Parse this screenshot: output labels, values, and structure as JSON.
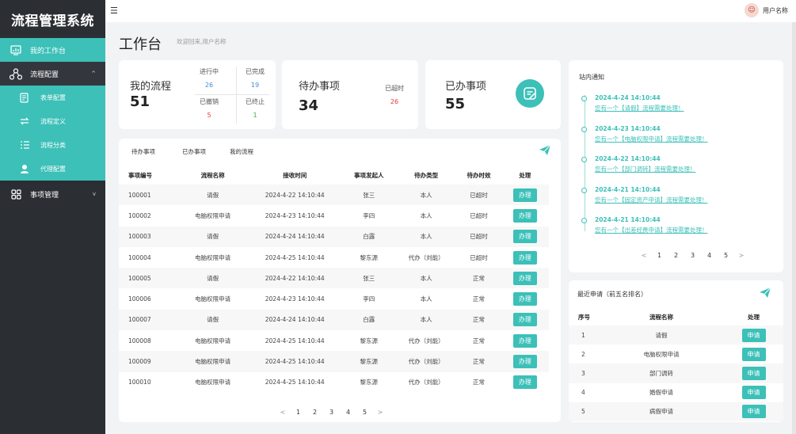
{
  "app": {
    "title": "流程管理系统"
  },
  "sidebar": {
    "items": [
      {
        "label": "我的工作台"
      },
      {
        "label": "流程配置"
      },
      {
        "label": "事项管理"
      }
    ],
    "sub_items": [
      {
        "label": "表单配置"
      },
      {
        "label": "流程定义"
      },
      {
        "label": "流程分类"
      },
      {
        "label": "代理配置"
      }
    ]
  },
  "topbar": {
    "user_name": "用户名称"
  },
  "header": {
    "title": "工作台",
    "subtitle": "欢迎回来,用户名称"
  },
  "stats": {
    "my_flow": {
      "title": "我的流程",
      "value": "51",
      "in_progress_label": "进行中",
      "in_progress": "26",
      "done_label": "已完成",
      "done": "19",
      "revoked_label": "已撤销",
      "revoked": "5",
      "stopped_label": "已终止",
      "stopped": "1"
    },
    "todo": {
      "title": "待办事项",
      "value": "34",
      "overdue_label": "已超时",
      "overdue": "26"
    },
    "done": {
      "title": "已办事项",
      "value": "55"
    }
  },
  "tasks": {
    "tabs": [
      "待办事项",
      "已办事项",
      "我的流程"
    ],
    "columns": [
      "事项编号",
      "流程名称",
      "接收时间",
      "事项发起人",
      "待办类型",
      "待办时效",
      "处理"
    ],
    "action_label": "办理",
    "rows": [
      {
        "id": "100001",
        "name": "请假",
        "time": "2024-4-22 14:10:44",
        "initiator": "张三",
        "type": "本人",
        "status": "已超时",
        "overdue": true
      },
      {
        "id": "100002",
        "name": "电脑权限申请",
        "time": "2024-4-23 14:10:44",
        "initiator": "李四",
        "type": "本人",
        "status": "已超时",
        "overdue": true
      },
      {
        "id": "100003",
        "name": "请假",
        "time": "2024-4-24 14:10:44",
        "initiator": "白露",
        "type": "本人",
        "status": "已超时",
        "overdue": true
      },
      {
        "id": "100004",
        "name": "电脑权限申请",
        "time": "2024-4-25 14:10:44",
        "initiator": "黎东源",
        "type": "代办（刘能）",
        "status": "已超时",
        "overdue": true
      },
      {
        "id": "100005",
        "name": "请假",
        "time": "2024-4-22 14:10:44",
        "initiator": "张三",
        "type": "本人",
        "status": "正常",
        "overdue": false
      },
      {
        "id": "100006",
        "name": "电脑权限申请",
        "time": "2024-4-23 14:10:44",
        "initiator": "李四",
        "type": "本人",
        "status": "正常",
        "overdue": false
      },
      {
        "id": "100007",
        "name": "请假",
        "time": "2024-4-24 14:10:44",
        "initiator": "白露",
        "type": "本人",
        "status": "正常",
        "overdue": false
      },
      {
        "id": "100008",
        "name": "电脑权限申请",
        "time": "2024-4-25 14:10:44",
        "initiator": "黎东源",
        "type": "代办（刘能）",
        "status": "正常",
        "overdue": false
      },
      {
        "id": "100009",
        "name": "电脑权限申请",
        "time": "2024-4-25 14:10:44",
        "initiator": "黎东源",
        "type": "代办（刘能）",
        "status": "正常",
        "overdue": false
      },
      {
        "id": "100010",
        "name": "电脑权限申请",
        "time": "2024-4-25 14:10:44",
        "initiator": "黎东源",
        "type": "代办（刘能）",
        "status": "正常",
        "overdue": false
      }
    ],
    "pager": {
      "prev": "<",
      "pages": [
        "1",
        "2",
        "3",
        "4",
        "5"
      ],
      "next": ">"
    }
  },
  "notifications": {
    "title": "站内通知",
    "items": [
      {
        "time": "2024-4-24 14:10:44",
        "message": "您有一个【请假】流程需要处理！"
      },
      {
        "time": "2024-4-23 14:10:44",
        "message": "您有一个【电脑权限申请】流程需要处理！"
      },
      {
        "time": "2024-4-22 14:10:44",
        "message": "您有一个【部门调转】流程需要处理！"
      },
      {
        "time": "2024-4-21 14:10:44",
        "message": "您有一个【固定资产申请】流程需要处理！"
      },
      {
        "time": "2024-4-21 14:10:44",
        "message": "您有一个【出差经费申请】流程需要处理！"
      }
    ],
    "pager": {
      "prev": "<",
      "pages": [
        "1",
        "2",
        "3",
        "4",
        "5"
      ],
      "next": ">"
    }
  },
  "recent": {
    "title": "最近申请（前五名排名）",
    "columns": [
      "序号",
      "流程名称",
      "处理"
    ],
    "action_label": "申请",
    "rows": [
      {
        "no": "1",
        "name": "请假"
      },
      {
        "no": "2",
        "name": "电脑权限申请"
      },
      {
        "no": "3",
        "name": "部门调转"
      },
      {
        "no": "4",
        "name": "婚假申请"
      },
      {
        "no": "5",
        "name": "病假申请"
      }
    ]
  },
  "colors": {
    "accent": "#3cc0b8",
    "sidebar": "#2b2e33",
    "overdue": "#e4393c"
  },
  "icons": {
    "menu_toggle": "menu-fold-icon",
    "send": "paper-plane-icon",
    "doc": "document-edit-icon"
  }
}
